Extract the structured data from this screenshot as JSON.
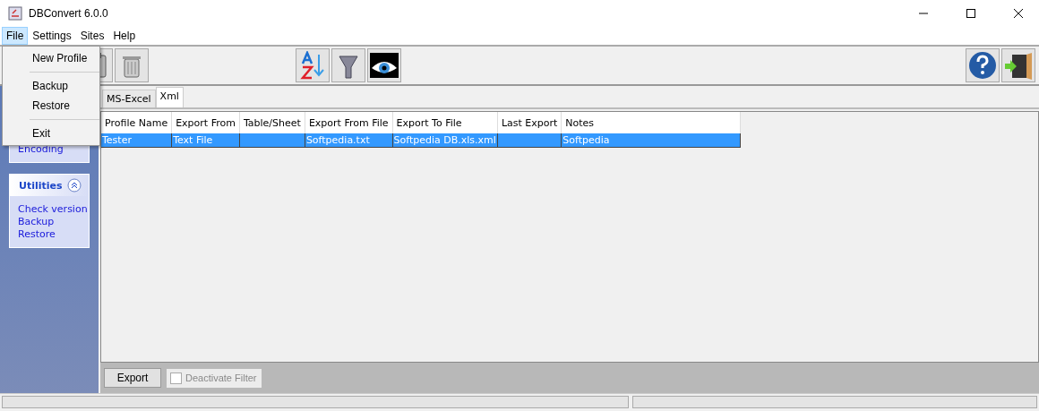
{
  "window": {
    "title": "DBConvert 6.0.0"
  },
  "menu_bar": [
    {
      "label": "File",
      "selected": true
    },
    {
      "label": "Settings",
      "selected": false
    },
    {
      "label": "Sites",
      "selected": false
    },
    {
      "label": "Help",
      "selected": false
    }
  ],
  "open_menu": {
    "items": [
      {
        "kind": "item",
        "label": "New Profile"
      },
      {
        "kind": "separator"
      },
      {
        "kind": "item",
        "label": "Backup"
      },
      {
        "kind": "item",
        "label": "Restore"
      },
      {
        "kind": "separator"
      },
      {
        "kind": "item",
        "label": "Exit"
      }
    ]
  },
  "sidebar": {
    "panels": [
      {
        "links": [
          "Encoding"
        ]
      },
      {
        "title": "Utilities",
        "expanded": true,
        "links": [
          "Check version",
          "Backup",
          "Restore"
        ]
      }
    ]
  },
  "tabs": [
    {
      "label": "MS-Excel",
      "selected": false
    },
    {
      "label": "Xml",
      "selected": true
    }
  ],
  "table": {
    "columns": [
      "Profile Name",
      "Export From",
      "Table/Sheet",
      "Export From File",
      "Export To File",
      "Last Export",
      "Notes"
    ],
    "rows": [
      {
        "selected": true,
        "cells": [
          "Tester",
          "Text File",
          "",
          "Softpedia.txt",
          "Softpedia DB.xls.xml",
          "",
          "Softpedia"
        ]
      }
    ]
  },
  "export_button": "Export",
  "deactivate_filter": {
    "label": "Deactivate Filter",
    "checked": false,
    "disabled": true
  }
}
